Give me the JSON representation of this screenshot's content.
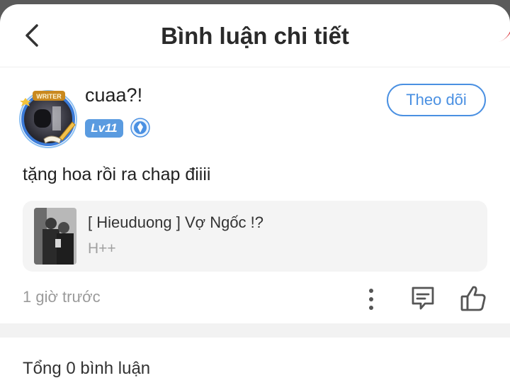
{
  "header": {
    "title": "Bình luận chi tiết",
    "back_icon": "chevron-left-icon"
  },
  "author": {
    "avatar_badge_text": "WRITER",
    "name": "cuaa?!",
    "level": "Lv11",
    "vip_icon": "vip-diamond-icon",
    "follow_label": "Theo dõi"
  },
  "comment": {
    "text": "tặng hoa rồi ra chap điiii"
  },
  "book": {
    "title": "[ Hieuduong ] Vợ Ngốc !?",
    "tag": "H++"
  },
  "meta": {
    "time": "1 giờ trước",
    "icons": [
      "more-vertical-icon",
      "comment-icon",
      "thumbs-up-icon"
    ]
  },
  "footer": {
    "total": "Tổng 0 bình luận"
  },
  "colors": {
    "accent": "#4a90e2",
    "level_badge": "#5a9be0",
    "muted": "#9a9a9a",
    "card_bg": "#f4f4f4"
  }
}
